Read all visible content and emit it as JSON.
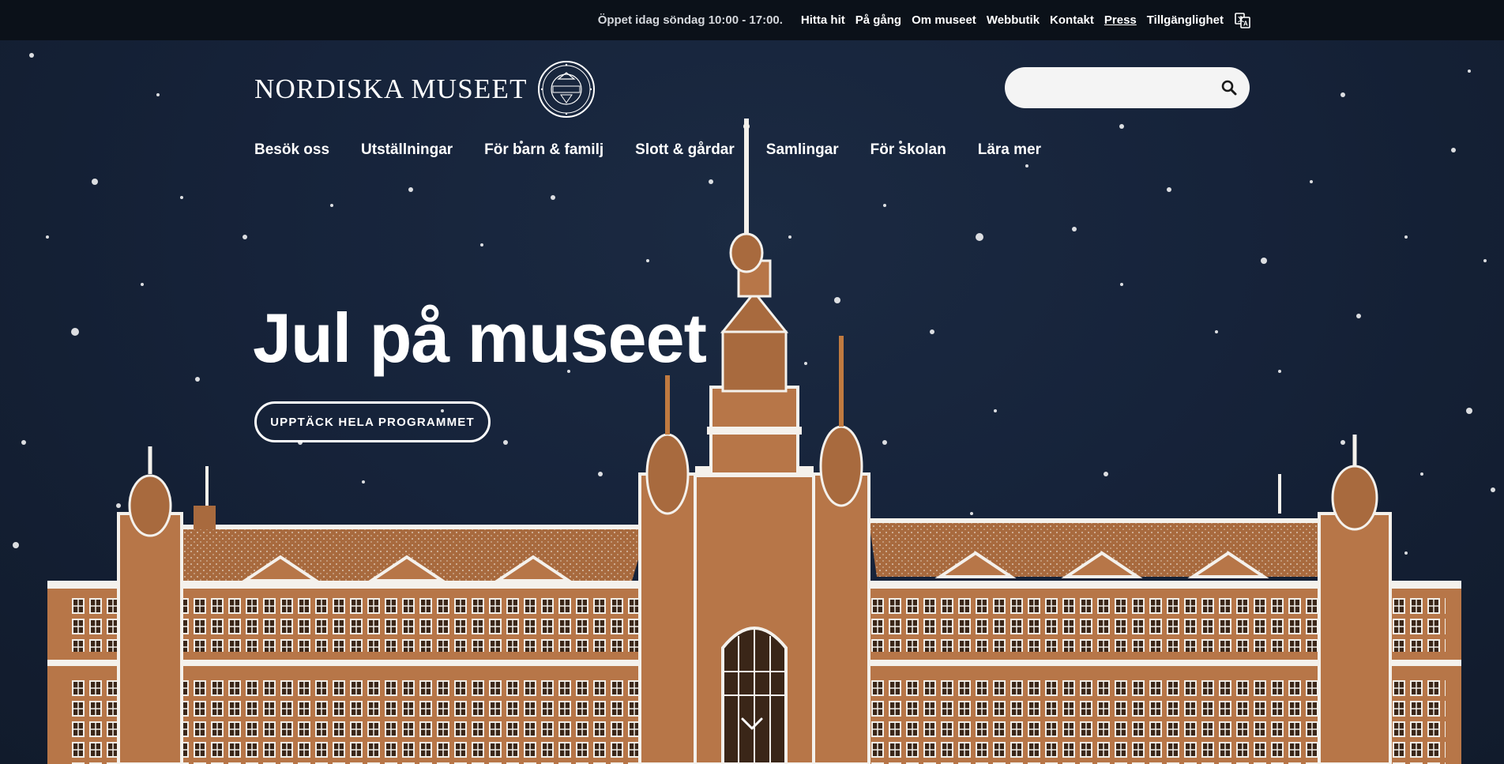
{
  "topbar": {
    "hours": "Öppet idag söndag 10:00 - 17:00.",
    "links": [
      {
        "label": "Hitta hit"
      },
      {
        "label": "På gång"
      },
      {
        "label": "Om museet"
      },
      {
        "label": "Webbutik"
      },
      {
        "label": "Kontakt"
      },
      {
        "label": "Press"
      },
      {
        "label": "Tillgänglighet"
      }
    ],
    "language_icon": "translate-icon"
  },
  "logo": {
    "text": "NORDISKA MUSEET",
    "seal_icon": "museum-seal-icon"
  },
  "search": {
    "placeholder": "",
    "value": "",
    "icon": "search-icon"
  },
  "nav": {
    "items": [
      {
        "label": "Besök oss"
      },
      {
        "label": "Utställningar"
      },
      {
        "label": "För barn & familj"
      },
      {
        "label": "Slott & gårdar"
      },
      {
        "label": "Samlingar"
      },
      {
        "label": "För skolan"
      },
      {
        "label": "Lära mer"
      }
    ]
  },
  "hero": {
    "title": "Jul på museet",
    "cta_label": "Upptäck hela programmet",
    "scroll_icon": "chevron-down-icon"
  },
  "colors": {
    "topbar_bg": "#0b1119",
    "hero_bg": "#16233a",
    "gingerbread": "#b0703f",
    "icing": "#f4f1ec"
  }
}
